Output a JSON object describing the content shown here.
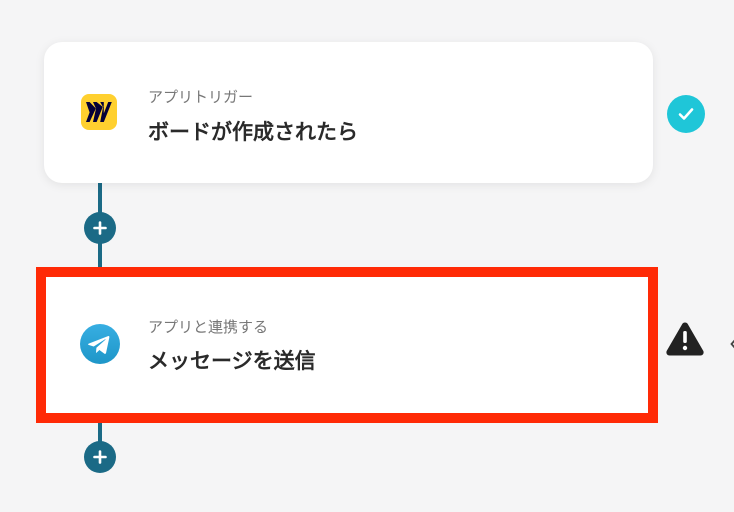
{
  "flow": {
    "steps": [
      {
        "type_label": "アプリトリガー",
        "title": "ボードが作成されたら",
        "app_icon": "miro-icon",
        "status": "completed",
        "status_icon": "check-icon"
      },
      {
        "type_label": "アプリと連携する",
        "title": "メッセージを送信",
        "app_icon": "telegram-icon",
        "status": "warning",
        "status_icon": "warning-icon",
        "highlighted": true
      }
    ],
    "add_button_icon": "plus-icon"
  },
  "colors": {
    "background": "#f5f5f6",
    "connector": "#1b6a86",
    "highlight_border": "#ff2a06",
    "success": "#1fc6d8",
    "warning": "#222222",
    "miro_yellow": "#ffd02f",
    "telegram_blue": "#2aa3e0"
  }
}
